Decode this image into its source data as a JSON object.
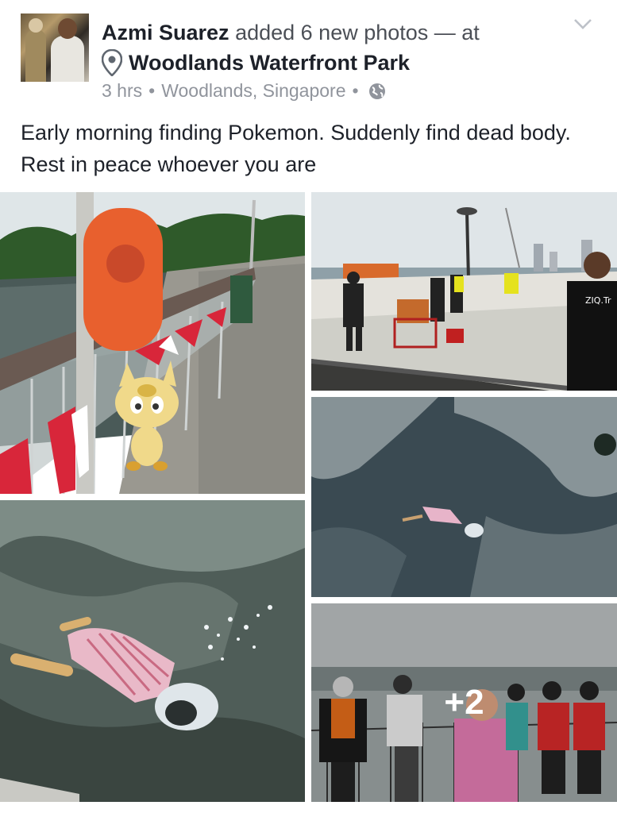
{
  "post": {
    "author": "Azmi Suarez",
    "action": "added 6 new photos — at",
    "location": "Woodlands Waterfront Park",
    "time": "3 hrs",
    "place": "Woodlands, Singapore",
    "separator": "•",
    "privacy_icon": "globe-icon",
    "text": "Early morning finding Pokemon. Suddenly find dead body. Rest in peace whoever you are"
  },
  "photos": {
    "more_count": "+2",
    "shirt_text": "ZIQ.Tr"
  },
  "icons": {
    "location": "map-pin-icon",
    "menu": "chevron-down-icon"
  },
  "colors": {
    "name": "#1d2129",
    "secondary": "#90949c",
    "background": "#ffffff"
  }
}
